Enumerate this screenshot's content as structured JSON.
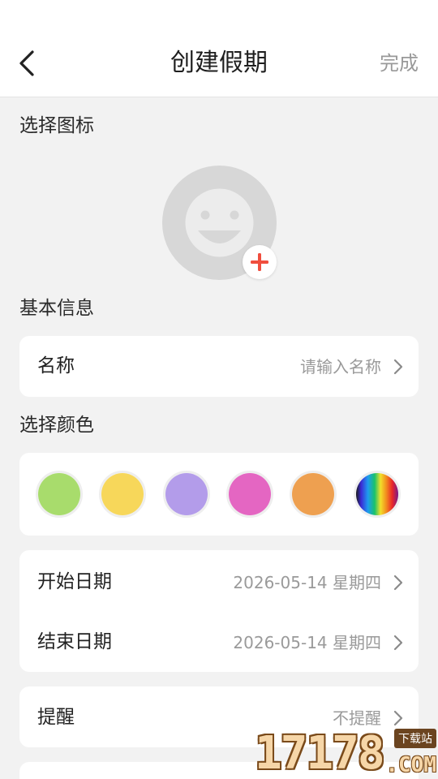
{
  "header": {
    "title": "创建假期",
    "done_label": "完成"
  },
  "icon_section": {
    "label": "选择图标"
  },
  "basic_info": {
    "label": "基本信息",
    "name_label": "名称",
    "name_placeholder": "请输入名称"
  },
  "color_section": {
    "label": "选择颜色",
    "colors": [
      "#a8dc6c",
      "#f7d75a",
      "#b39cea",
      "#e466c2",
      "#eea050",
      "rainbow"
    ]
  },
  "dates": {
    "start_label": "开始日期",
    "start_value": "2026-05-14 星期四",
    "end_label": "结束日期",
    "end_value": "2026-05-14 星期四"
  },
  "reminder": {
    "label": "提醒",
    "value": "不提醒"
  },
  "watermark": {
    "number": "17178",
    "tag": "下载站",
    "suffix": ".COM"
  },
  "accent_color": "#f04e3e"
}
